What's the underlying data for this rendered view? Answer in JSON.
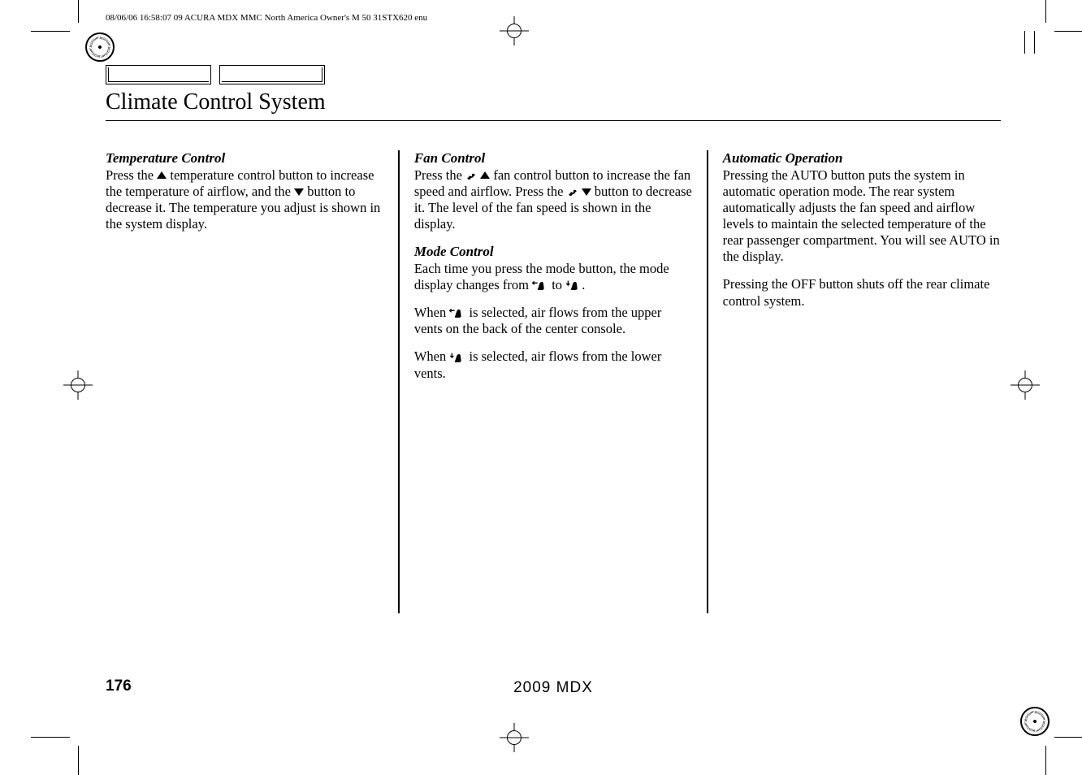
{
  "header": "08/06/06 16:58:07   09 ACURA MDX MMC North America Owner's M 50 31STX620 enu",
  "title": "Climate Control System",
  "col1": {
    "h1": "Temperature Control",
    "p1a": "Press the ",
    "p1b": " temperature control button to increase the temperature of airflow, and the ",
    "p1c": " button to decrease it. The temperature you adjust is shown in the system display."
  },
  "col2": {
    "h1": "Fan Control",
    "p1a": "Press the ",
    "p1b": " ",
    "p1c": " fan control button to increase the fan speed and airflow. Press the ",
    "p1d": " ",
    "p1e": " button to decrease it. The level of the fan speed is shown in the display.",
    "h2": "Mode Control",
    "p2a": "Each time you press the mode button, the mode display changes from ",
    "p2b": " to ",
    "p2c": ".",
    "p3a": "When ",
    "p3b": " is selected, air flows from the upper vents on the back of the center console.",
    "p4a": "When ",
    "p4b": " is selected, air flows from the lower vents."
  },
  "col3": {
    "h1": "Automatic Operation",
    "p1": "Pressing the AUTO button puts the system in automatic operation mode. The rear system automatically adjusts the fan speed and airflow levels to maintain the selected temperature of the rear passenger compartment. You will see AUTO in the display.",
    "p2": "Pressing the OFF button shuts off the rear climate control system."
  },
  "pageNumber": "176",
  "model": "2009  MDX"
}
